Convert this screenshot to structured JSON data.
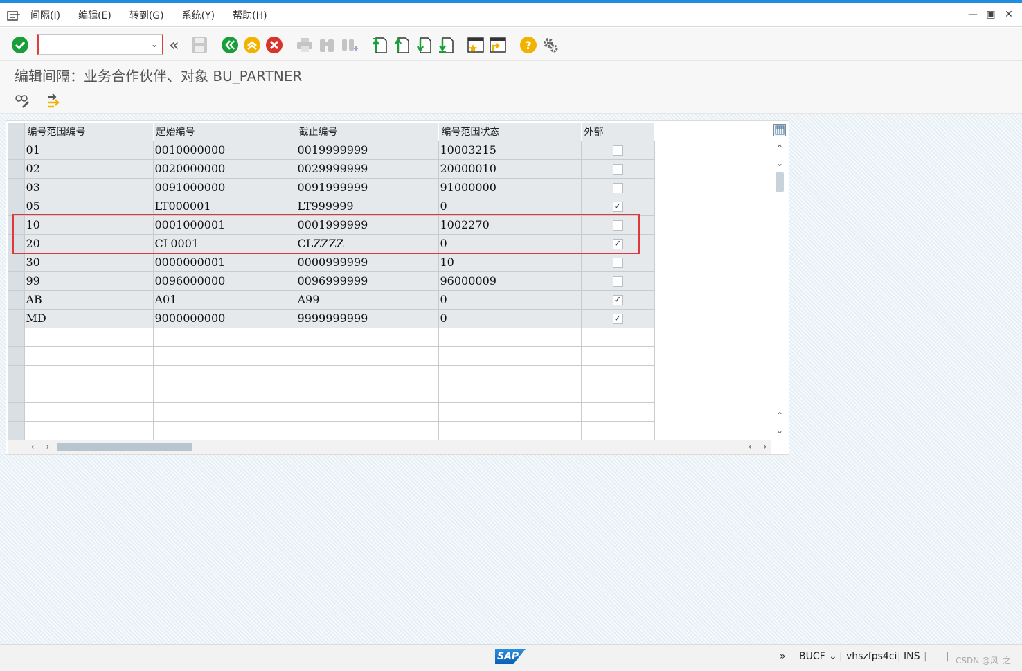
{
  "menubar": {
    "items": [
      "间隔(I)",
      "编辑(E)",
      "转到(G)",
      "系统(Y)",
      "帮助(H)"
    ]
  },
  "toolbar": {
    "command_field_value": "",
    "icons": [
      "enter-icon",
      "command-field",
      "back-arrows-icon",
      "save-icon",
      "back-icon",
      "exit-icon",
      "cancel-icon",
      "print-icon",
      "find-icon",
      "find-next-icon",
      "first-page-icon",
      "previous-page-icon",
      "next-page-icon",
      "last-page-icon",
      "create-session-icon",
      "shortcut-icon",
      "help-icon",
      "customize-icon"
    ]
  },
  "title": "编辑间隔：业务合作伙伴、对象 BU_PARTNER",
  "table": {
    "columns": [
      "编号范围编号",
      "起始编号",
      "截止编号",
      "编号范围状态",
      "外部"
    ],
    "rows": [
      {
        "no": "01",
        "from": "0010000000",
        "to": "0019999999",
        "status": "10003215",
        "ext": false
      },
      {
        "no": "02",
        "from": "0020000000",
        "to": "0029999999",
        "status": "20000010",
        "ext": false
      },
      {
        "no": "03",
        "from": "0091000000",
        "to": "0091999999",
        "status": "91000000",
        "ext": false
      },
      {
        "no": "05",
        "from": "LT000001",
        "to": "LT999999",
        "status": "0",
        "ext": true
      },
      {
        "no": "10",
        "from": "0001000001",
        "to": "0001999999",
        "status": "1002270",
        "ext": false
      },
      {
        "no": "20",
        "from": "CL0001",
        "to": "CLZZZZ",
        "status": "0",
        "ext": true
      },
      {
        "no": "30",
        "from": "0000000001",
        "to": "0000999999",
        "status": "10",
        "ext": false
      },
      {
        "no": "99",
        "from": "0096000000",
        "to": "0096999999",
        "status": "96000009",
        "ext": false
      },
      {
        "no": "AB",
        "from": "A01",
        "to": "A99",
        "status": "0",
        "ext": true
      },
      {
        "no": "MD",
        "from": "9000000000",
        "to": "9999999999",
        "status": "0",
        "ext": true
      }
    ],
    "highlighted_rows": [
      "10",
      "20"
    ]
  },
  "statusbar": {
    "logo": "SAP",
    "transaction": "BUCF",
    "server": "vhszfps4ci",
    "mode": "INS",
    "watermark": "CSDN @风_之"
  },
  "colors": {
    "accent_top": "#1f8de0",
    "highlight": "#e0373a",
    "enter_green": "#1a9e3a",
    "cancel_red": "#d9342b",
    "exit_yellow": "#f2b300"
  }
}
